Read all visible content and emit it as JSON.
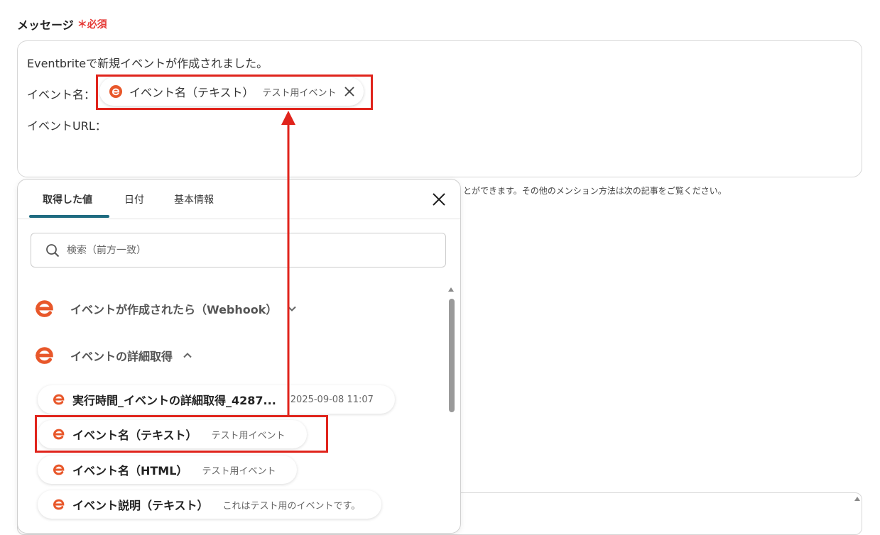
{
  "field": {
    "label": "メッセージ",
    "required_mark": "＊",
    "required": "必須"
  },
  "message": {
    "line1": "Eventbriteで新規イベントが作成されました。",
    "line2_prefix": "イベント名：",
    "line3": "イベントURL：",
    "chip": {
      "name": "イベント名（テキスト）",
      "value": "テスト用イベント"
    }
  },
  "hint": "とができます。その他のメンション方法は次の記事をご覧ください。",
  "panel": {
    "tabs": [
      "取得した値",
      "日付",
      "基本情報"
    ],
    "search_placeholder": "検索（前方一致）",
    "sections": [
      {
        "title": "イベントが作成されたら（Webhook）",
        "state": "collapsed"
      },
      {
        "title": "イベントの詳細取得",
        "state": "expanded"
      }
    ],
    "items": [
      {
        "name": "実行時間_イベントの詳細取得_4287...",
        "value": "2025-09-08 11:07"
      },
      {
        "name": "イベント名（テキスト）",
        "value": "テスト用イベント"
      },
      {
        "name": "イベント名（HTML）",
        "value": "テスト用イベント"
      },
      {
        "name": "イベント説明（テキスト）",
        "value": "これはテスト用のイベントです。"
      }
    ]
  },
  "colors": {
    "brand": "#e8572a",
    "highlight": "#e0241c",
    "tab_active": "#1f6b80",
    "required": "#e53935"
  },
  "icons": [
    "eventbrite-icon",
    "close-icon",
    "search-icon",
    "chevron-down-icon",
    "chevron-up-icon"
  ]
}
